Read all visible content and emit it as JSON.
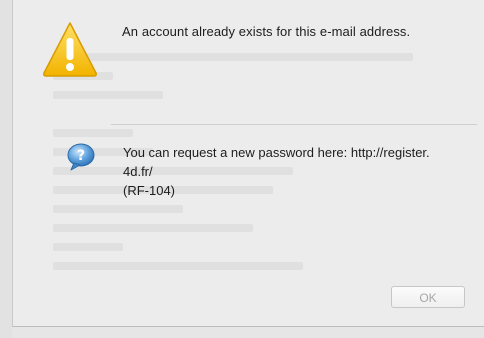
{
  "alert": {
    "title": "An account already exists for this e-mail address.",
    "message_lines": [
      "You can request a new password here:  http://register.",
      "4d.fr/",
      "(RF-104)"
    ]
  },
  "buttons": {
    "ok_label": "OK"
  },
  "icons": {
    "warning": "warning-triangle-icon",
    "help": "help-bubble-icon"
  },
  "colors": {
    "warning_yellow": "#f7c21a",
    "help_blue": "#3f86c8"
  }
}
